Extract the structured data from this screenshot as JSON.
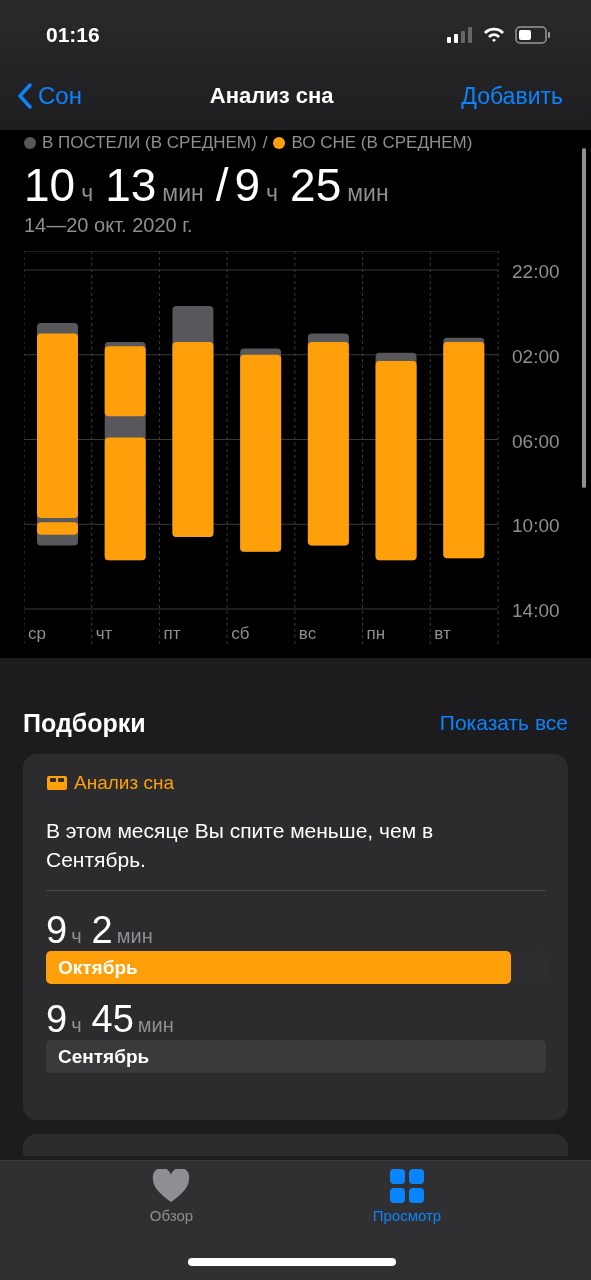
{
  "status_bar": {
    "time": "01:16"
  },
  "nav": {
    "back": "Сон",
    "title": "Анализ сна",
    "action": "Добавить"
  },
  "summary": {
    "legend": [
      {
        "label": "В ПОСТЕЛИ (В СРЕДНЕМ)",
        "color": "#58585c"
      },
      {
        "label": "ВО СНЕ (В СРЕДНЕМ)",
        "color": "#ff9f0a"
      }
    ],
    "separator": "/",
    "values": [
      {
        "hours": "10",
        "h_unit": "ч",
        "minutes": "13",
        "m_unit": "мин"
      },
      {
        "hours": "9",
        "h_unit": "ч",
        "minutes": "25",
        "m_unit": "мин"
      }
    ],
    "range": "14—20 окт. 2020 г."
  },
  "chart": {
    "time_labels": [
      "22:00",
      "02:00",
      "06:00",
      "10:00",
      "14:00"
    ],
    "days": [
      "ср",
      "чт",
      "пт",
      "сб",
      "вс",
      "пн",
      "вт"
    ]
  },
  "highlights": {
    "title": "Подборки",
    "show_all": "Показать все",
    "card": {
      "category": "Анализ сна",
      "text": "В этом месяце Вы спите меньше, чем в Сентябрь.",
      "rows": [
        {
          "hours": "9",
          "h_unit": "ч",
          "minutes": "2",
          "m_unit": "мин",
          "label": "Октябрь",
          "level": 0.93,
          "kind": "current"
        },
        {
          "hours": "9",
          "h_unit": "ч",
          "minutes": "45",
          "m_unit": "мин",
          "label": "Сентябрь",
          "level": 1.0,
          "kind": "previous"
        }
      ]
    }
  },
  "tab_bar": [
    {
      "label": "Обзор",
      "kind": "heart",
      "selected": false
    },
    {
      "label": "Просмотр",
      "kind": "grid",
      "selected": true
    }
  ]
}
